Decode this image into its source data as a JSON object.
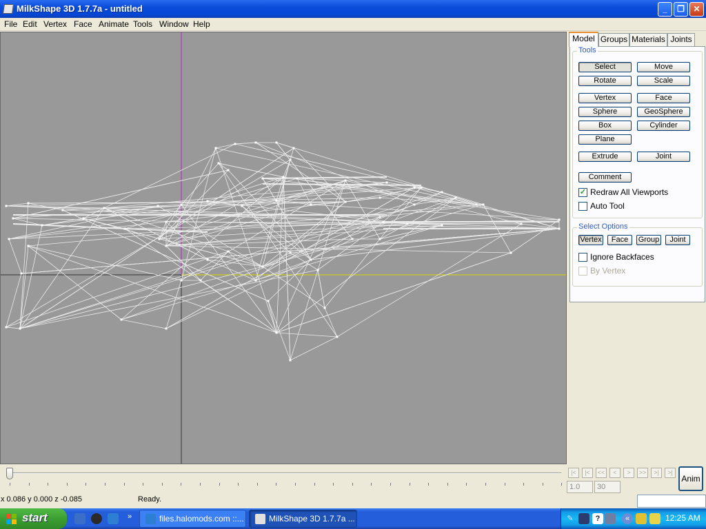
{
  "window": {
    "title": "MilkShape 3D 1.7.7a - untitled",
    "min_glyph": "_",
    "max_glyph": "❐",
    "close_glyph": "✕"
  },
  "menu": [
    "File",
    "Edit",
    "Vertex",
    "Face",
    "Animate",
    "Tools",
    "Window",
    "Help"
  ],
  "tabs": [
    "Model",
    "Groups",
    "Materials",
    "Joints"
  ],
  "tools": {
    "group_label": "Tools",
    "buttons": [
      "Select",
      "Move",
      "Rotate",
      "Scale",
      "Vertex",
      "Face",
      "Sphere",
      "GeoSphere",
      "Box",
      "Cylinder",
      "Plane",
      "Extrude",
      "Joint",
      "Comment"
    ],
    "redraw_all_viewports": "Redraw All Viewports",
    "auto_tool": "Auto Tool"
  },
  "select_options": {
    "group_label": "Select Options",
    "buttons": [
      "Vertex",
      "Face",
      "Group",
      "Joint"
    ],
    "ignore_backfaces": "Ignore Backfaces",
    "by_vertex": "By Vertex"
  },
  "timeline": {
    "nav": [
      "|<",
      "|<",
      "<<",
      "<",
      ">",
      ">>",
      ">|",
      ">|"
    ],
    "frame_start": "1.0",
    "frame_end": "30",
    "anim_button": "Anim"
  },
  "status": {
    "coords": "x 0.086 y 0.000 z -0.085",
    "message": "Ready."
  },
  "taskbar": {
    "start": "start",
    "quicklaunch_more": "»",
    "tasks": [
      "files.halomods.com ::...",
      "MilkShape 3D 1.7.7a ..."
    ],
    "tray_more": "«",
    "clock": "12:25 AM"
  },
  "colors": {
    "viewport_bg": "#999999",
    "wire": "#ececec",
    "axis_vertical": "#c020c0",
    "axis_horizontal": "#d8d800",
    "axis_black": "#333333"
  }
}
